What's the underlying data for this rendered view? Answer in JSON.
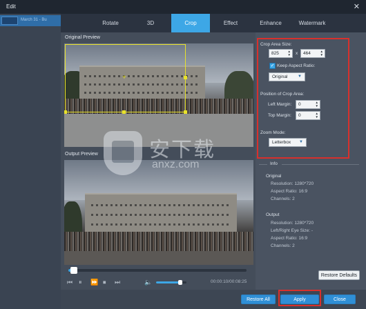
{
  "window": {
    "title": "Edit",
    "close_glyph": "✕"
  },
  "sidebar": {
    "file_name": "March 31 - Bu"
  },
  "tabs": [
    {
      "label": "Rotate",
      "active": false
    },
    {
      "label": "3D",
      "active": false
    },
    {
      "label": "Crop",
      "active": true
    },
    {
      "label": "Effect",
      "active": false
    },
    {
      "label": "Enhance",
      "active": false
    },
    {
      "label": "Watermark",
      "active": false
    }
  ],
  "previews": {
    "original_label": "Original Preview",
    "output_label": "Output Preview"
  },
  "playback": {
    "time": "00:00:10/00:08:25",
    "progress_fraction": 0.02,
    "volume_fraction": 0.8,
    "icons": [
      "skip-back-icon",
      "pause-icon",
      "fast-forward-icon",
      "stop-icon",
      "skip-forward-icon",
      "volume-icon"
    ]
  },
  "crop": {
    "area_size_label": "Crop Area Size:",
    "width": "825",
    "times": "x",
    "height": "464",
    "keep_aspect_label": "Keep Aspect Ratio:",
    "keep_aspect_checked": true,
    "aspect_value": "Original",
    "position_label": "Position of Crop Area:",
    "left_margin_label": "Left Margin:",
    "left_margin": "0",
    "top_margin_label": "Top Margin:",
    "top_margin": "0",
    "zoom_mode_label": "Zoom Mode:",
    "zoom_mode": "Letterbox"
  },
  "info": {
    "heading": "Info",
    "original_heading": "Original",
    "original_resolution": "Resolution: 1280*720",
    "original_aspect": "Aspect Ratio: 16:9",
    "original_channels": "Channels: 2",
    "output_heading": "Output",
    "output_resolution": "Resolution: 1280*720",
    "output_eye": "Left/Right Eye Size: -",
    "output_aspect": "Aspect Ratio: 16:9",
    "output_channels": "Channels: 2"
  },
  "buttons": {
    "restore_defaults": "Restore Defaults",
    "restore_all": "Restore All",
    "apply": "Apply",
    "close": "Close"
  },
  "watermark": {
    "big_text": "安下载",
    "small_text": "anxz.com"
  },
  "colors": {
    "accent": "#3da7e6",
    "highlight_red": "#d9302c",
    "crop_yellow": "#e8e22a"
  }
}
